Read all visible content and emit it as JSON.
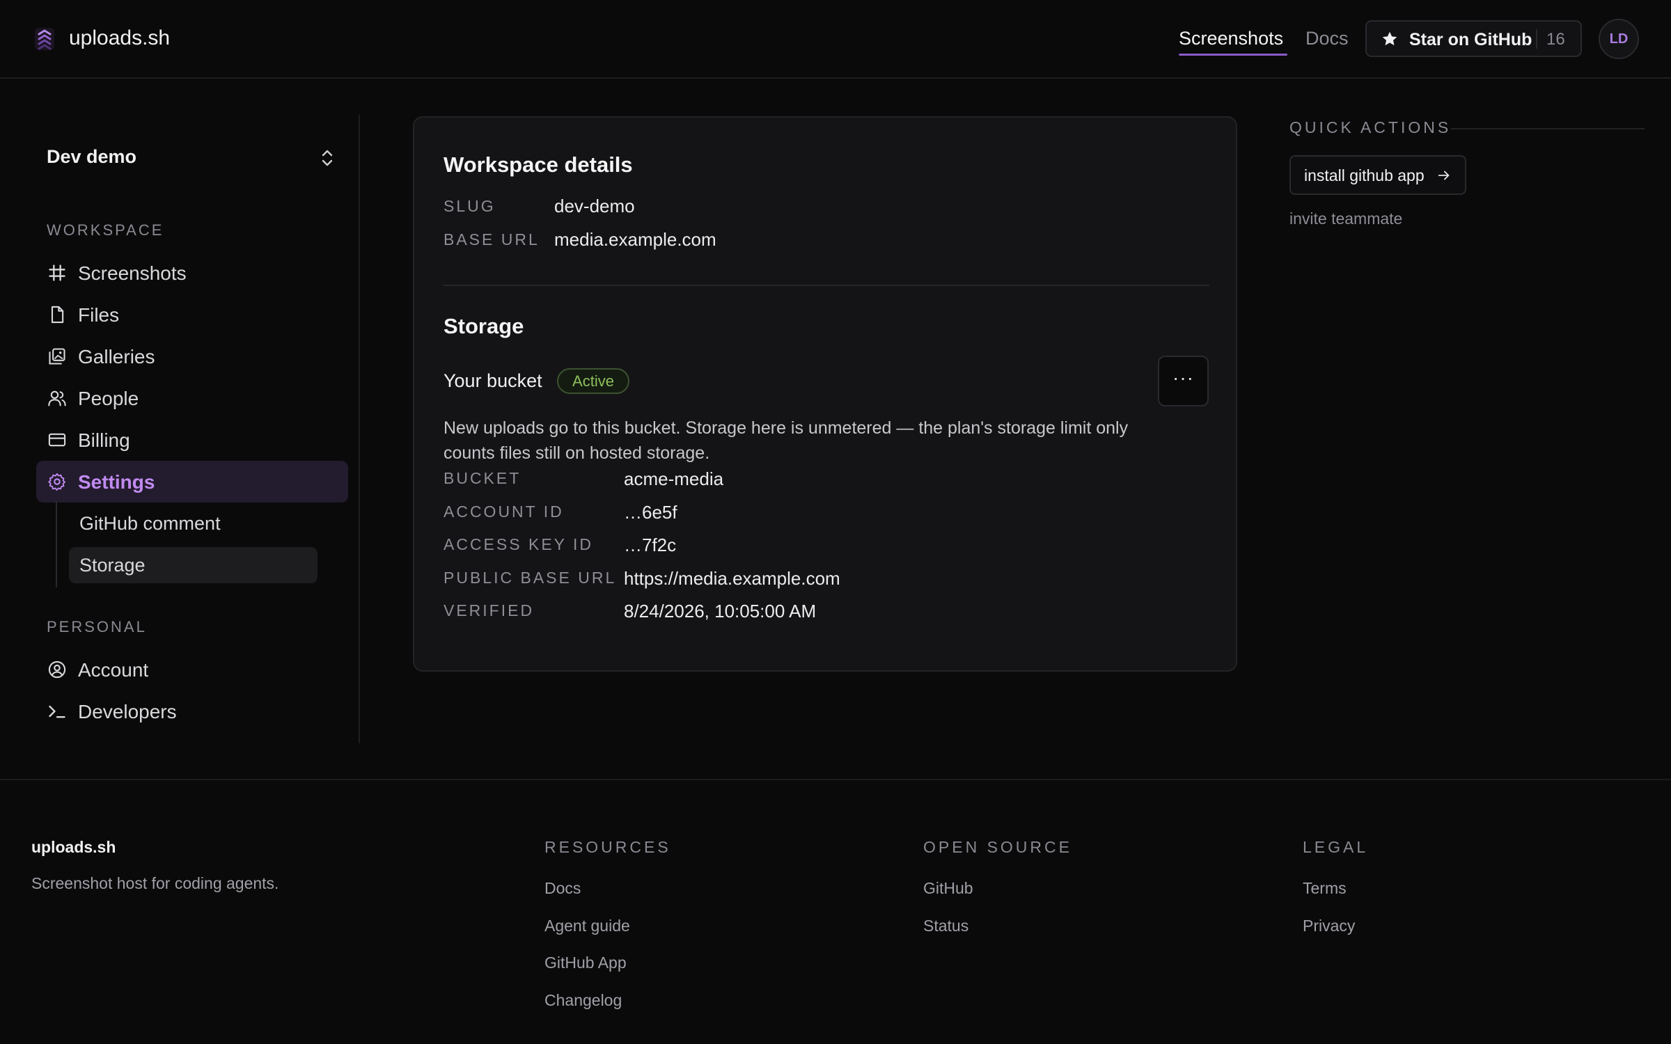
{
  "header": {
    "brand": "uploads.sh",
    "nav": [
      {
        "label": "Screenshots",
        "active": true
      },
      {
        "label": "Docs",
        "active": false
      }
    ],
    "star": {
      "label": "Star on GitHub",
      "count": "16"
    },
    "avatar": "LD",
    "accent_color": "#8b5cc7"
  },
  "sidebar": {
    "workspace_switcher": "Dev demo",
    "workspace_label": "WORKSPACE",
    "workspace_items": [
      {
        "label": "Screenshots",
        "icon": "hash-icon"
      },
      {
        "label": "Files",
        "icon": "file-icon"
      },
      {
        "label": "Galleries",
        "icon": "gallery-icon"
      },
      {
        "label": "People",
        "icon": "people-icon"
      },
      {
        "label": "Billing",
        "icon": "credit-card-icon"
      },
      {
        "label": "Settings",
        "icon": "gear-icon",
        "active": true
      }
    ],
    "settings_subitems": [
      {
        "label": "GitHub comment"
      },
      {
        "label": "Storage",
        "selected": true
      }
    ],
    "personal_label": "PERSONAL",
    "personal_items": [
      {
        "label": "Account",
        "icon": "user-circle-icon"
      },
      {
        "label": "Developers",
        "icon": "terminal-icon"
      }
    ]
  },
  "workspace_details": {
    "title": "Workspace details",
    "rows": [
      {
        "key": "SLUG",
        "value": "dev-demo"
      },
      {
        "key": "BASE URL",
        "value": "media.example.com"
      }
    ]
  },
  "storage": {
    "title": "Storage",
    "bucket_label": "Your bucket",
    "status": "Active",
    "status_color": "#8fbf5c",
    "more_label": "···",
    "description": "New uploads go to this bucket. Storage here is unmetered — the plan's storage limit only counts files still on hosted storage.",
    "rows": [
      {
        "key": "BUCKET",
        "value": "acme-media"
      },
      {
        "key": "ACCOUNT ID",
        "value": "…6e5f"
      },
      {
        "key": "ACCESS KEY ID",
        "value": "…7f2c"
      },
      {
        "key": "PUBLIC BASE URL",
        "value": "https://media.example.com"
      },
      {
        "key": "VERIFIED",
        "value": "8/24/2026, 10:05:00 AM"
      }
    ]
  },
  "quick_actions": {
    "label": "QUICK ACTIONS",
    "primary": "install github app",
    "secondary": "invite teammate"
  },
  "footer": {
    "brand": "uploads.sh",
    "tagline": "Screenshot host for coding agents.",
    "columns": [
      {
        "heading": "RESOURCES",
        "links": [
          "Docs",
          "Agent guide",
          "GitHub App",
          "Changelog"
        ]
      },
      {
        "heading": "OPEN SOURCE",
        "links": [
          "GitHub",
          "Status"
        ]
      },
      {
        "heading": "LEGAL",
        "links": [
          "Terms",
          "Privacy"
        ]
      }
    ]
  }
}
